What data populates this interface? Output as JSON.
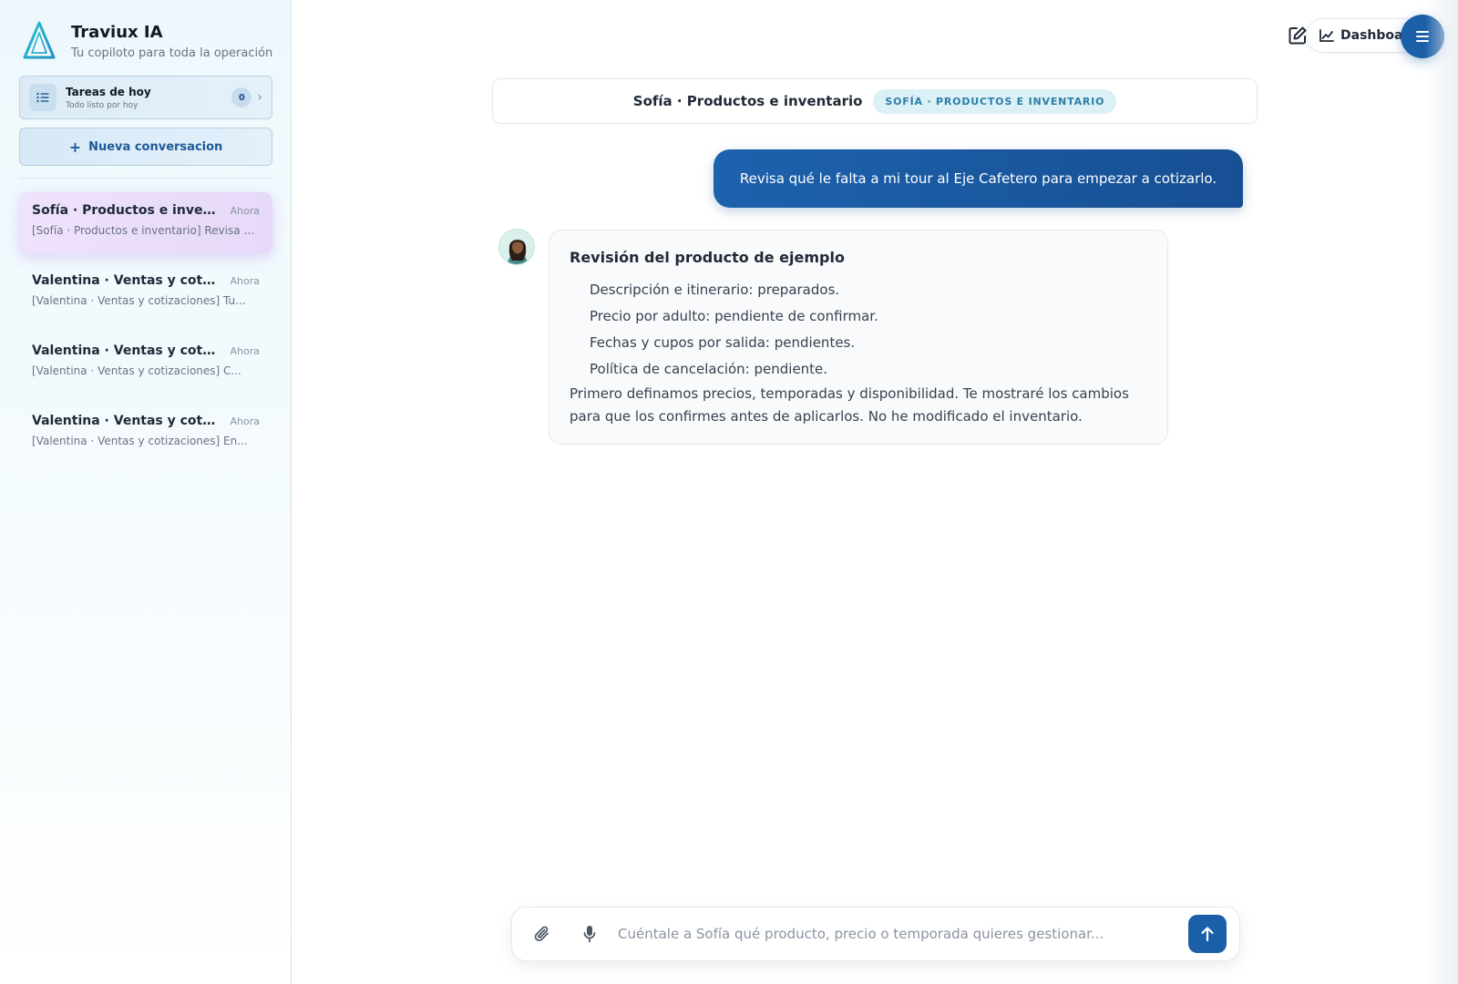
{
  "app": {
    "title": "Traviux IA",
    "subtitle": "Tu copiloto para toda la operación"
  },
  "tasks": {
    "title": "Tareas de hoy",
    "subtitle": "Todo listo por hoy",
    "count": "0"
  },
  "sidebar": {
    "new_conversation_label": "Nueva conversacion",
    "conversations": [
      {
        "title": "Sofía · Productos e inventario",
        "time": "Ahora",
        "preview": "[Sofía · Productos e inventario] Revisa qué le falta a mi tour al Eje Cafetero para empezar a cotizarlo.",
        "active": true
      },
      {
        "title": "Valentina · Ventas y cotizaciones",
        "time": "Ahora",
        "preview": "[Valentina · Ventas y cotizaciones] Tu...",
        "active": false
      },
      {
        "title": "Valentina · Ventas y cotizaciones",
        "time": "Ahora",
        "preview": "[Valentina · Ventas y cotizaciones] C...",
        "active": false
      },
      {
        "title": "Valentina · Ventas y cotizaciones",
        "time": "Ahora",
        "preview": "[Valentina · Ventas y cotizaciones] En...",
        "active": false
      }
    ]
  },
  "topbar": {
    "dashboard_label": "Dashboard"
  },
  "chat": {
    "header_title": "Sofía · Productos e inventario",
    "header_badge": "SOFÍA · PRODUCTOS E INVENTARIO",
    "user_message": "Revisa qué le falta a mi tour al Eje Cafetero para empezar a cotizarlo.",
    "assistant": {
      "title": "Revisión del producto de ejemplo",
      "items": [
        "Descripción e itinerario: preparados.",
        "Precio por adulto: pendiente de confirmar.",
        "Fechas y cupos por salida: pendientes.",
        "Política de cancelación: pendiente."
      ],
      "paragraph": "Primero definamos precios, temporadas y disponibilidad. Te mostraré los cambios para que los confirmes antes de aplicarlos. No he modificado el inventario."
    }
  },
  "composer": {
    "placeholder": "Cuéntale a Sofía qué producto, precio o temporada quieres gestionar..."
  },
  "icons": {
    "logo": "triangle-logo-icon",
    "tasks": "list-icon",
    "chevron": "chevron-right-icon",
    "plus": "plus-icon",
    "edit": "edit-icon",
    "dashboard": "chart-line-icon",
    "menu": "hamburger-menu-icon",
    "attach": "paperclip-icon",
    "mic": "microphone-icon",
    "send": "arrow-up-icon"
  },
  "colors": {
    "primary": "#1b5fa8",
    "accent_teal": "#2bb3c7",
    "active_conversation": "#e9dcfa",
    "badge_bg": "#dcf0f8"
  }
}
